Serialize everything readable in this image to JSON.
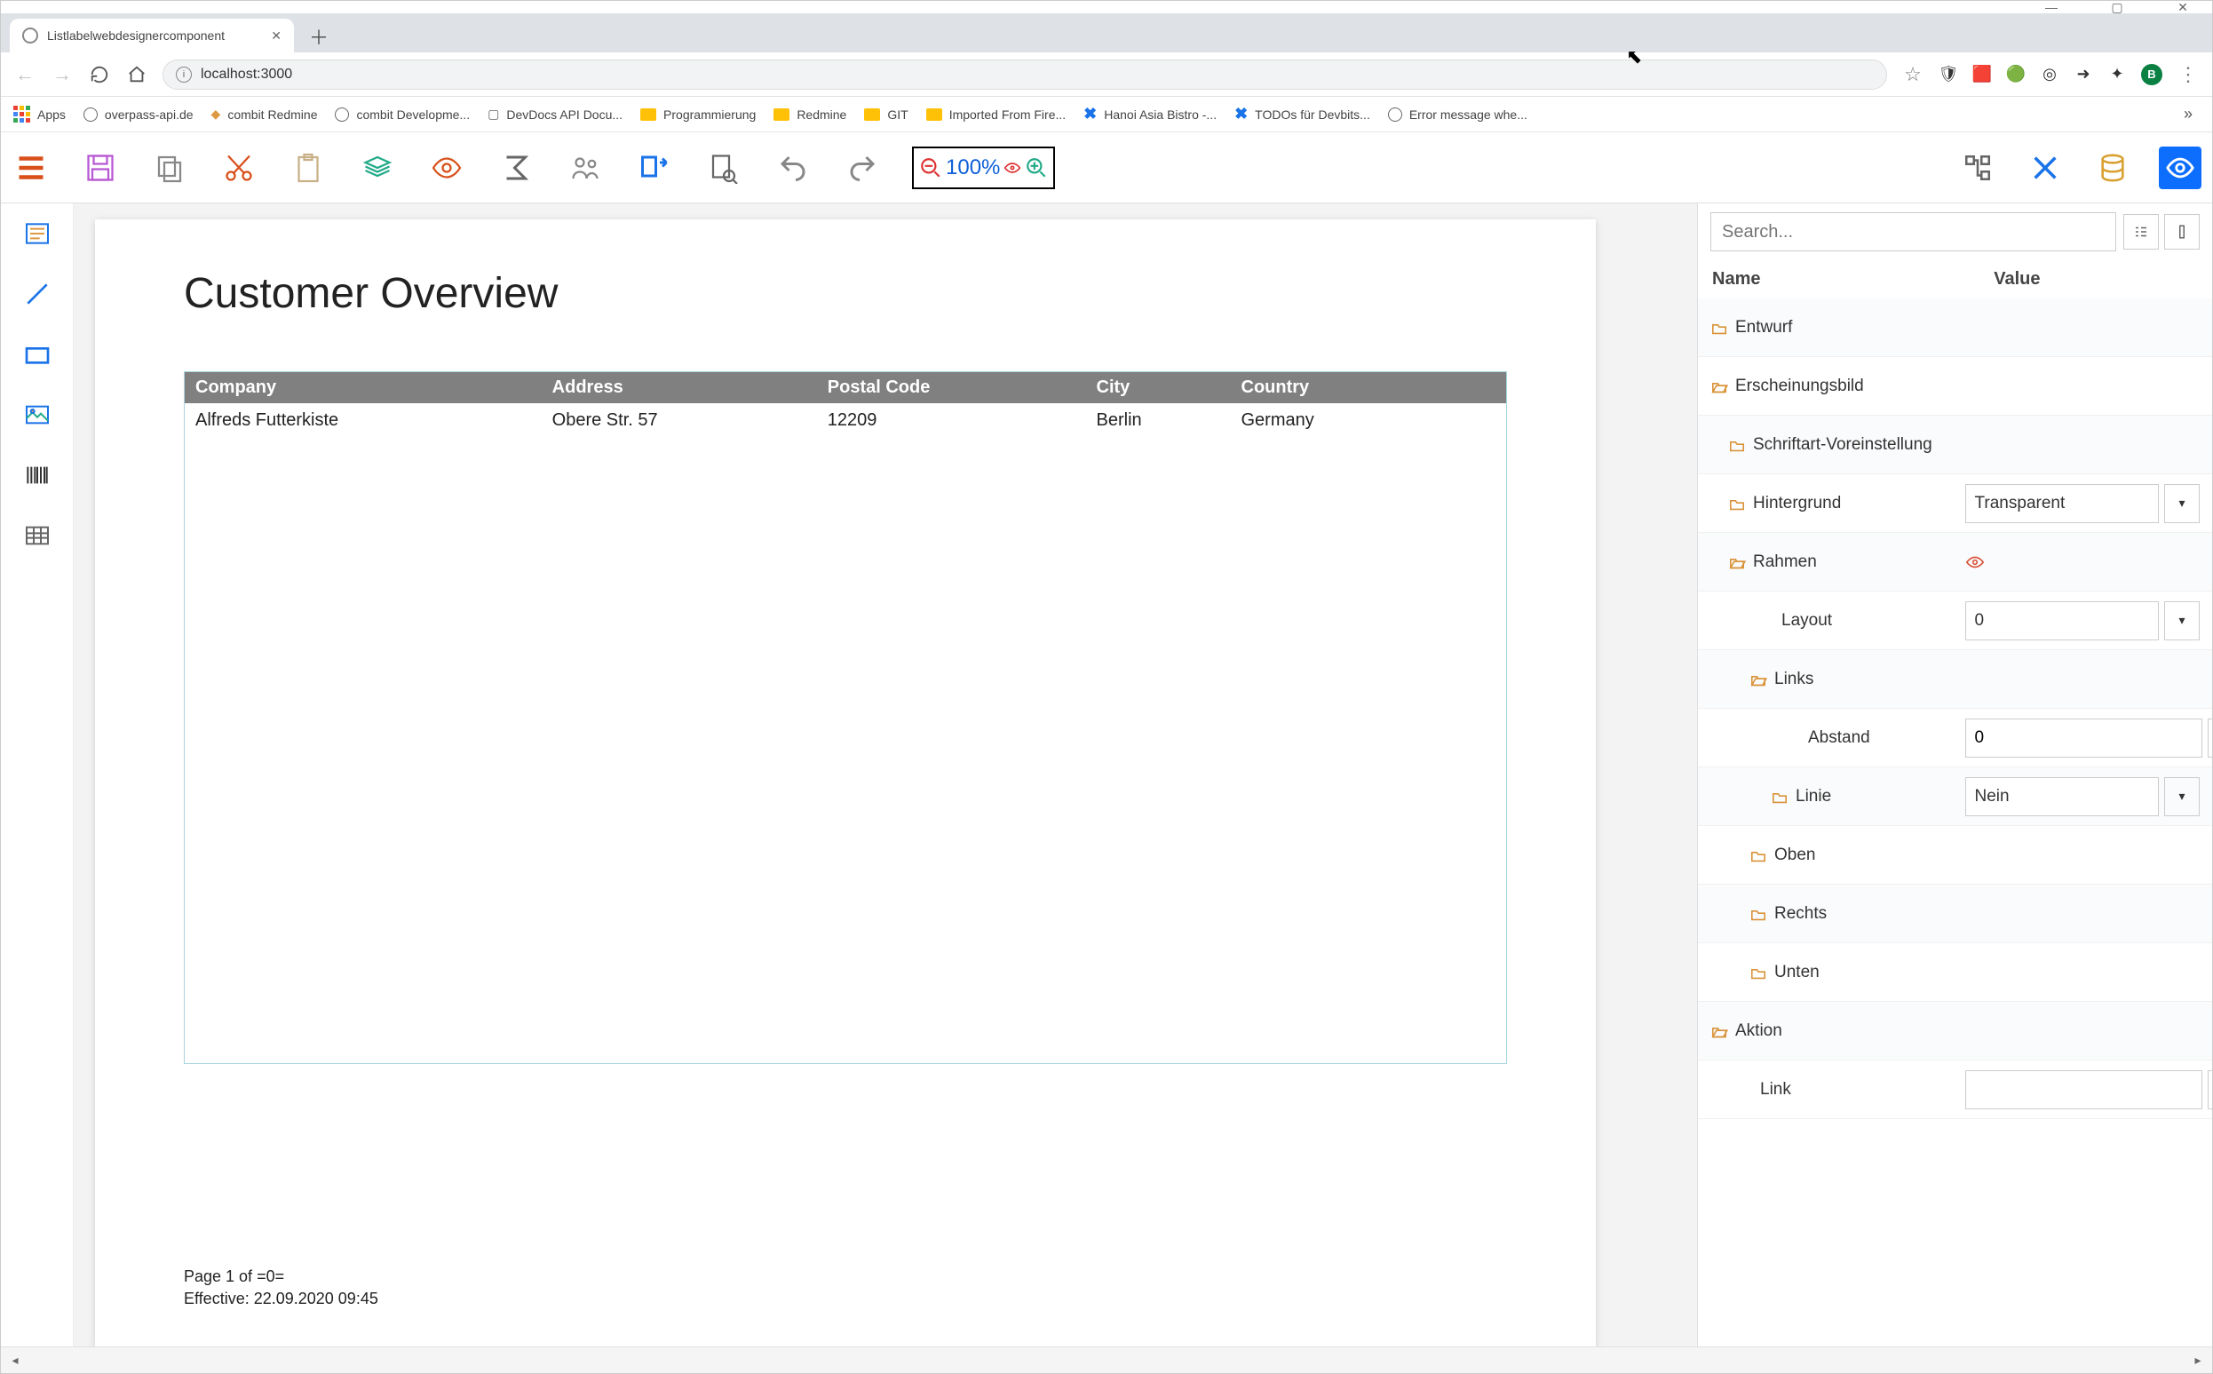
{
  "browser": {
    "tab_title": "Listlabelwebdesignercomponent",
    "url": "localhost:3000",
    "win_controls": {
      "min": "—",
      "max": "▢",
      "close": "✕"
    },
    "nav": {
      "back": "←",
      "forward": "→",
      "reload": "⟳",
      "home": "⌂",
      "star": "☆",
      "menu": "⋮"
    },
    "ext_icons": {
      "shield": "🛡",
      "red": "🟥",
      "green": "🟢",
      "circle": "◎",
      "google_arrow": "➜",
      "puzzle": "✦"
    },
    "avatar": "B",
    "bookmarks": [
      {
        "icon": "apps",
        "label": "Apps"
      },
      {
        "icon": "globe",
        "label": "overpass-api.de"
      },
      {
        "icon": "redmine",
        "label": "combit Redmine"
      },
      {
        "icon": "globe",
        "label": "combit Developme..."
      },
      {
        "icon": "devdocs",
        "label": "DevDocs API Docu..."
      },
      {
        "icon": "folder",
        "label": "Programmierung"
      },
      {
        "icon": "folder",
        "label": "Redmine"
      },
      {
        "icon": "folder",
        "label": "GIT"
      },
      {
        "icon": "folder",
        "label": "Imported From Fire..."
      },
      {
        "icon": "x",
        "label": "Hanoi Asia Bistro -..."
      },
      {
        "icon": "x",
        "label": "TODOs für Devbits..."
      },
      {
        "icon": "globe",
        "label": "Error message whe..."
      }
    ],
    "bookmarks_more": "»"
  },
  "toolbar": {
    "zoom_text": "100%"
  },
  "report": {
    "title": "Customer Overview",
    "columns": [
      "Company",
      "Address",
      "Postal Code",
      "City",
      "Country"
    ],
    "rows": [
      {
        "company": "Alfreds Futterkiste",
        "address": "Obere Str. 57",
        "postal": "12209",
        "city": "Berlin",
        "country": "Germany"
      }
    ],
    "footer_page": "Page 1 of =0=",
    "footer_date": "Effective: 22.09.2020 09:45"
  },
  "panel": {
    "search_placeholder": "Search...",
    "header_name": "Name",
    "header_value": "Value",
    "rows": {
      "entwurf": "Entwurf",
      "erscheinungsbild": "Erscheinungsbild",
      "schriftart": "Schriftart-Voreinstellung",
      "hintergrund": "Hintergrund",
      "hintergrund_val": "Transparent",
      "rahmen": "Rahmen",
      "layout": "Layout",
      "layout_val": "0",
      "links": "Links",
      "abstand": "Abstand",
      "abstand_val": "0",
      "linie": "Linie",
      "linie_val": "Nein",
      "oben": "Oben",
      "rechts": "Rechts",
      "unten": "Unten",
      "aktion": "Aktion",
      "link": "Link",
      "link_val": ""
    }
  }
}
